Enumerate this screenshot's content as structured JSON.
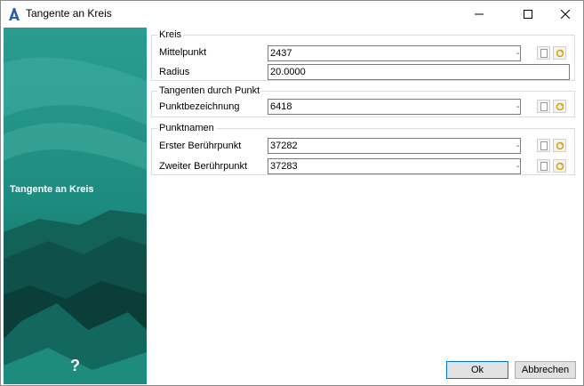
{
  "window": {
    "title": "Tangente an Kreis"
  },
  "side": {
    "title": "Tangente an Kreis",
    "help": "?"
  },
  "kreis": {
    "label": "Kreis",
    "mittelpunkt_label": "Mittelpunkt",
    "mittelpunkt_value": "2437",
    "radius_label": "Radius",
    "radius_value": "20.0000"
  },
  "tangenten": {
    "label": "Tangenten durch Punkt",
    "punkt_label": "Punktbezeichnung",
    "punkt_value": "6418"
  },
  "punktnamen": {
    "label": "Punktnamen",
    "erster_label": "Erster Berührpunkt",
    "erster_value": "37282",
    "zweiter_label": "Zweiter Berührpunkt",
    "zweiter_value": "37283"
  },
  "field_suffix": "-",
  "buttons": {
    "ok": "Ok",
    "cancel": "Abbrechen"
  },
  "colors": {
    "teal": "#1a8f82",
    "dark": "#0c3b37",
    "ok_border": "#0078d7"
  }
}
